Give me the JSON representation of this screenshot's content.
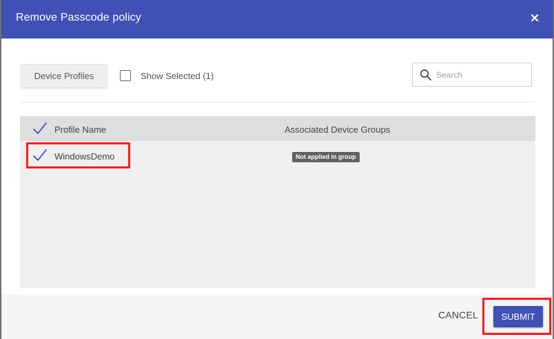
{
  "dialog": {
    "title": "Remove Passcode policy",
    "close_icon": "close-icon"
  },
  "toolbar": {
    "device_profiles_label": "Device Profiles",
    "show_selected_label": "Show Selected (1)",
    "show_selected_checked": false,
    "search": {
      "icon": "search-icon",
      "placeholder": "Search",
      "value": ""
    }
  },
  "table": {
    "columns": [
      "Profile Name",
      "Associated Device Groups"
    ],
    "rows": [
      {
        "selected": true,
        "profile_name": "WindowsDemo",
        "group_badge": "Not applied in group"
      }
    ]
  },
  "footer": {
    "cancel_label": "CANCEL",
    "submit_label": "SUBMIT"
  },
  "colors": {
    "header": "#3f51b5",
    "primary_button": "#3f51b5",
    "annotation_highlight": "#ff1a1a",
    "badge": "#616161",
    "check": "#3f51b5"
  }
}
